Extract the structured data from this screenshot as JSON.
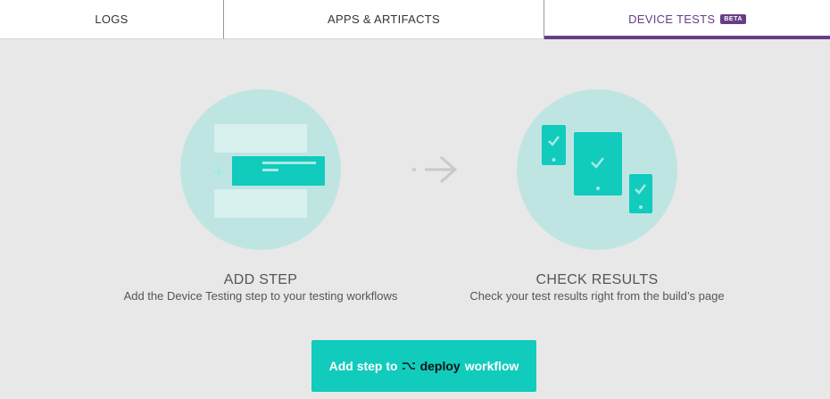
{
  "tabs": [
    {
      "label": "LOGS"
    },
    {
      "label": "APPS & ARTIFACTS"
    },
    {
      "label": "DEVICE TESTS",
      "badge": "BETA",
      "active": true
    }
  ],
  "steps": [
    {
      "title": "ADD STEP",
      "description": "Add the Device Testing step to your testing workflows"
    },
    {
      "title": "CHECK RESULTS",
      "description": "Check your test results right from the build’s page"
    }
  ],
  "cta": {
    "prefix": "Add step to",
    "workflow_name": "deploy",
    "suffix": "workflow",
    "icon": "workflow-icon"
  },
  "icons": {
    "step_icon": "add-step-illustration",
    "arrow_icon": "arrow-right-icon",
    "results_icon": "devices-checkmark-illustration"
  },
  "colors": {
    "accent_purple": "#683d87",
    "teal": "#11cbbd",
    "light_teal": "#bfe5e2",
    "background": "#e8e8e8"
  }
}
